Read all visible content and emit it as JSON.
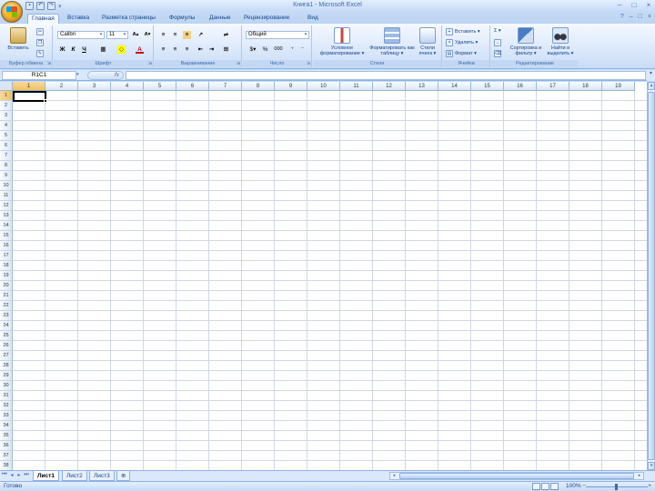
{
  "window": {
    "title": "Книга1 - Microsoft Excel",
    "controls": [
      "–",
      "□",
      "×"
    ]
  },
  "qat": {
    "icons": [
      "save-icon",
      "undo-icon",
      "redo-icon"
    ],
    "separator": "▾"
  },
  "ribbon_tabs": [
    {
      "label": "Главная",
      "active": true
    },
    {
      "label": "Вставка",
      "active": false
    },
    {
      "label": "Разметка страницы",
      "active": false
    },
    {
      "label": "Формулы",
      "active": false
    },
    {
      "label": "Данные",
      "active": false
    },
    {
      "label": "Рецензирование",
      "active": false
    },
    {
      "label": "Вид",
      "active": false
    }
  ],
  "ribbon": {
    "clipboard": {
      "label": "Буфер обмена",
      "paste": "Вставить"
    },
    "font": {
      "label": "Шрифт",
      "name": "Calibri",
      "size": "11",
      "bold": "Ж",
      "italic": "К",
      "underline": "Ч",
      "grow": "A▴",
      "shrink": "A▾"
    },
    "alignment": {
      "label": "Выравнивание"
    },
    "number": {
      "label": "Число",
      "format": "Общий",
      "percent": "%",
      "thousands": "000"
    },
    "styles": {
      "label": "Стили",
      "conditional": "Условное форматирование ▾",
      "as_table": "Форматировать как таблицу ▾",
      "cell_styles": "Стили ячеек ▾"
    },
    "cells": {
      "label": "Ячейки",
      "insert": "Вставить ▾",
      "delete": "Удалить ▾",
      "format": "Формат ▾"
    },
    "editing": {
      "label": "Редактирование",
      "sum": "Σ ▾",
      "sort": "Сортировка и фильтр ▾",
      "find": "Найти и выделить ▾"
    }
  },
  "formula_bar": {
    "name_box": "R1C1",
    "fx": "fx",
    "value": ""
  },
  "columns": [
    "1",
    "2",
    "3",
    "4",
    "5",
    "6",
    "7",
    "8",
    "9",
    "10",
    "11",
    "12",
    "13",
    "14",
    "15",
    "16",
    "17",
    "18",
    "19"
  ],
  "rows": [
    "1",
    "2",
    "3",
    "4",
    "5",
    "6",
    "7",
    "8",
    "9",
    "10",
    "11",
    "12",
    "13",
    "14",
    "15",
    "16",
    "17",
    "18",
    "19",
    "20",
    "21",
    "22",
    "23",
    "24",
    "25",
    "26",
    "27",
    "28",
    "29",
    "30",
    "31",
    "32",
    "33",
    "34",
    "35",
    "36",
    "37",
    "38"
  ],
  "selection": {
    "row": 1,
    "col": 1
  },
  "sheets": [
    {
      "label": "Лист1",
      "active": true
    },
    {
      "label": "Лист2",
      "active": false
    },
    {
      "label": "Лист3",
      "active": false
    }
  ],
  "status": {
    "ready": "Готово",
    "zoom": "100%",
    "zoom_minus": "−",
    "zoom_plus": "+"
  },
  "colors": {
    "accent": "#15428b",
    "ribbon_bg": "#dbe8fb",
    "selected_header": "#f1c15f",
    "gridline": "#d0d7e5"
  }
}
